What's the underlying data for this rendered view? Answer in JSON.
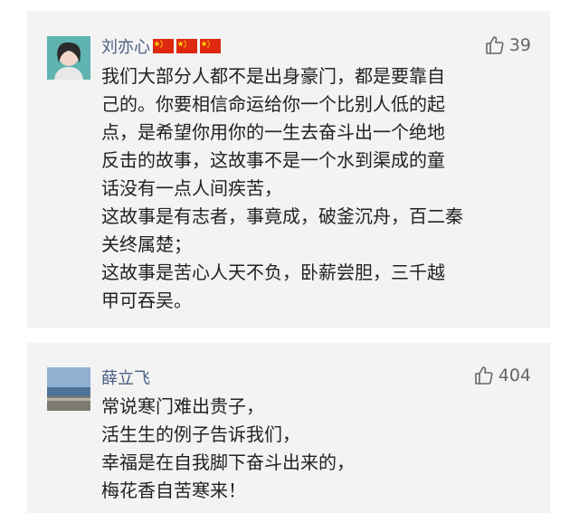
{
  "comments": [
    {
      "username": "刘亦心",
      "likes": "39",
      "flag_count": 3,
      "lines": [
        "我们大部分人都不是出身豪门，都是要靠自",
        "己的。你要相信命运给你一个比别人低的起",
        "点，是希望你用你的一生去奋斗出一个绝地",
        "反击的故事，这故事不是一个水到渠成的童",
        "话没有一点人间疾苦，",
        "这故事是有志者，事竟成，破釜沉舟，百二秦",
        "关终属楚；",
        "这故事是苦心人天不负，卧薪尝胆，三千越",
        "甲可吞吴。"
      ]
    },
    {
      "username": "薛立飞",
      "likes": "404",
      "lines": [
        "常说寒门难出贵子，",
        "活生生的例子告诉我们，",
        "幸福是在自我脚下奋斗出来的，",
        "梅花香自苦寒来！"
      ]
    }
  ],
  "colors": {
    "card_bg": "#f3f3f3",
    "username": "#4a5e83",
    "text": "#222222",
    "likes": "#666666",
    "flag_red": "#de2910",
    "flag_star": "#ffde00"
  },
  "icons": {
    "like": "thumbs-up-icon",
    "flag": "china-flag-icon"
  }
}
